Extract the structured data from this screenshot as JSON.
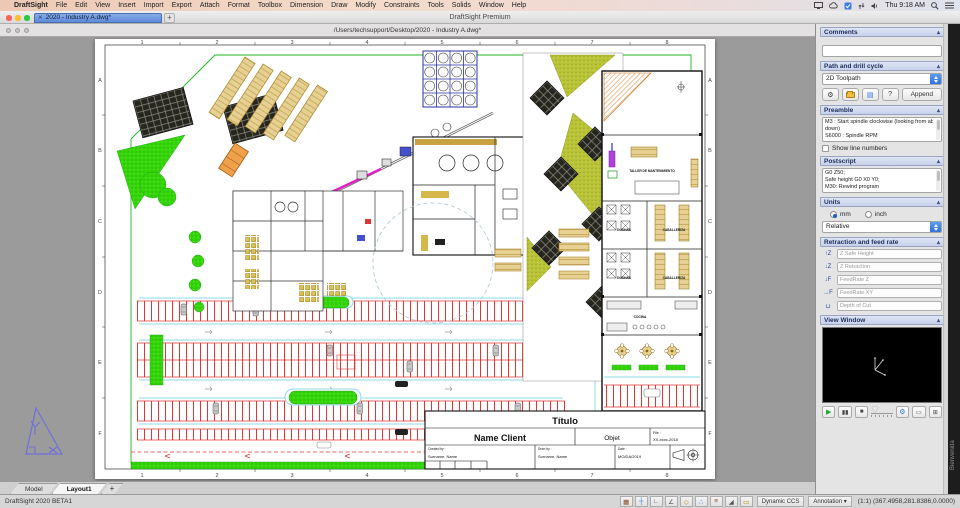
{
  "menubar": {
    "apple": "",
    "items": [
      "DraftSight",
      "File",
      "Edit",
      "View",
      "Insert",
      "Import",
      "Export",
      "Attach",
      "Format",
      "Toolbox",
      "Dimension",
      "Draw",
      "Modify",
      "Constraints",
      "Tools",
      "Solids",
      "Window",
      "Help"
    ],
    "clock": "Thu 9:18 AM"
  },
  "window": {
    "title": "DraftSight Premium",
    "tab_label": "2020 - Industry A.dwg*",
    "tab_close": "✕",
    "new_tab": "+",
    "doc_path": "/Users/techsupport/Desktop/2020 - Industry A.dwg*"
  },
  "panel": {
    "comments": {
      "title": "Comments",
      "collapse": "▴"
    },
    "toolpath": {
      "title": "Path and drill cycle",
      "collapse": "▴",
      "selected": "2D Toolpath",
      "gear": "⚙",
      "blue_doc": "▤",
      "help": "?",
      "append": "Append"
    },
    "preamble": {
      "title": "Preamble",
      "collapse": "▴",
      "lines": [
        "M3     : Start spindle clockwise (looking from abov",
        "down)",
        "S6000 : Spindle RPM"
      ],
      "show_line_numbers": "Show line numbers"
    },
    "postscript": {
      "title": "Postscript",
      "collapse": "▴",
      "lines": [
        "G0 Z50;",
        "Safe height G0 X0 Y0;",
        "M30: Rewind program"
      ]
    },
    "units": {
      "title": "Units",
      "collapse": "▴",
      "mm": "mm",
      "inch": "inch",
      "mode": "Relative"
    },
    "retraction": {
      "title": "Retraction and feed rate",
      "collapse": "▴",
      "fields": [
        "Z Safe Height",
        "Z Retraction",
        "FeedRate Z",
        "FeedRate XY",
        "Depth of Cut"
      ],
      "icons": [
        "↑Z",
        "↓Z",
        "↓F",
        "→F",
        "⊔"
      ]
    },
    "view": {
      "title": "View Window",
      "collapse": "▴",
      "play": "▶",
      "pause": "▮▮",
      "stop": "■",
      "settings": "⚙",
      "window": "▭",
      "grid": "⊞"
    }
  },
  "welcome_tab": "Bienvenida",
  "sheet_tabs": {
    "model": "Model",
    "layout": "Layout1",
    "add": "+"
  },
  "statusbar": {
    "version": "DraftSight 2020 BETA1",
    "icons": [
      "▦",
      "┼",
      "∟",
      "∠",
      "◇",
      "∴",
      "≡",
      "◢",
      "▭"
    ],
    "dynamic_ccs": "Dynamic CCS",
    "annotation": "Annotation",
    "annotation_arrow": "▾",
    "coords": "(1:1)  (367.4958,281.8386,0.0000)"
  },
  "drawing": {
    "grid_cols": [
      "1",
      "2",
      "3",
      "4",
      "5",
      "6",
      "7",
      "8"
    ],
    "grid_rows": [
      "A",
      "B",
      "C",
      "D",
      "E",
      "F"
    ],
    "labels": {
      "taller": "TALLER DE MANTENIMIENTO",
      "duchas": "DUCHAS",
      "caballeriza": "CABALLERIZA",
      "cocina": "COCINA"
    },
    "title_block": {
      "title": "Título",
      "client": "Name Client",
      "object": "Objet",
      "file_label": "File :",
      "file_value": "XX-xxxx-2018",
      "created_label": "Created by :",
      "created_value": "Surname, Name",
      "drawn_label": "Drwn by :",
      "drawn_value": "Surname, Name",
      "date_label": "Date :",
      "date_value": "MO/DA/2019"
    },
    "colors": {
      "stall_red": "#e03636",
      "grass": "#35d60a",
      "olive": "#b9c337",
      "tan": "#e6d193",
      "panel_dark": "#26261f",
      "cyan": "#8fd8ea",
      "magenta": "#e020c0",
      "blue": "#4450cc",
      "orange": "#efa04a"
    }
  }
}
